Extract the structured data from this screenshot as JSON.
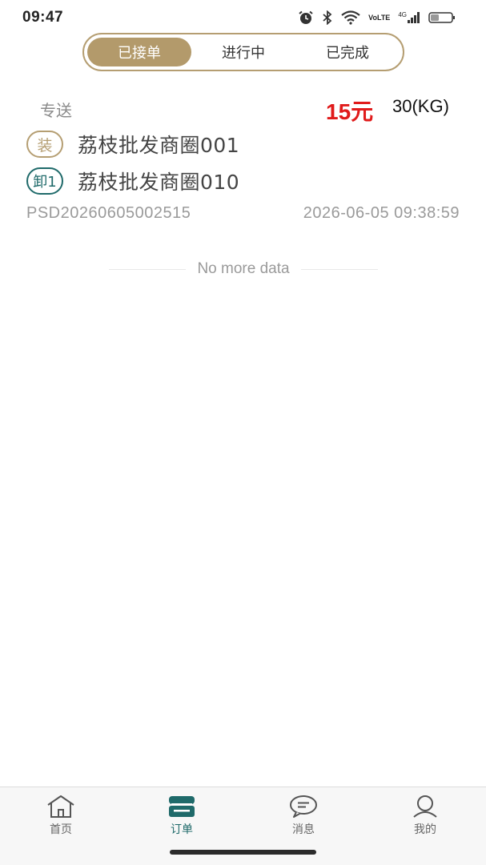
{
  "status_bar": {
    "time": "09:47",
    "volte_line1": "Vo",
    "volte_line2": "LTE",
    "network": "4G",
    "icons": [
      "alarm-icon",
      "bluetooth-icon",
      "wifi-icon",
      "volte-icon",
      "signal-icon",
      "battery-icon"
    ]
  },
  "tabs": {
    "items": [
      {
        "label": "已接单",
        "active": true
      },
      {
        "label": "进行中",
        "active": false
      },
      {
        "label": "已完成",
        "active": false
      }
    ],
    "accent_color": "#b39a6b"
  },
  "orders": [
    {
      "type": "专送",
      "price": "15元",
      "weight": "30(KG)",
      "load_badge": "装",
      "load_address": "荔枝批发商圈001",
      "unload_badge": "卸1",
      "unload_address": "荔枝批发商圈010",
      "order_no": "PSD20260605002515",
      "time": "2026-06-05 09:38:59"
    }
  ],
  "list_end_text": "No more data",
  "tabbar": {
    "items": [
      {
        "label": "首页",
        "icon": "home-icon",
        "active": false
      },
      {
        "label": "订单",
        "icon": "order-icon",
        "active": true
      },
      {
        "label": "消息",
        "icon": "message-icon",
        "active": false
      },
      {
        "label": "我的",
        "icon": "profile-icon",
        "active": false
      }
    ],
    "active_color": "#1f6a6a"
  }
}
